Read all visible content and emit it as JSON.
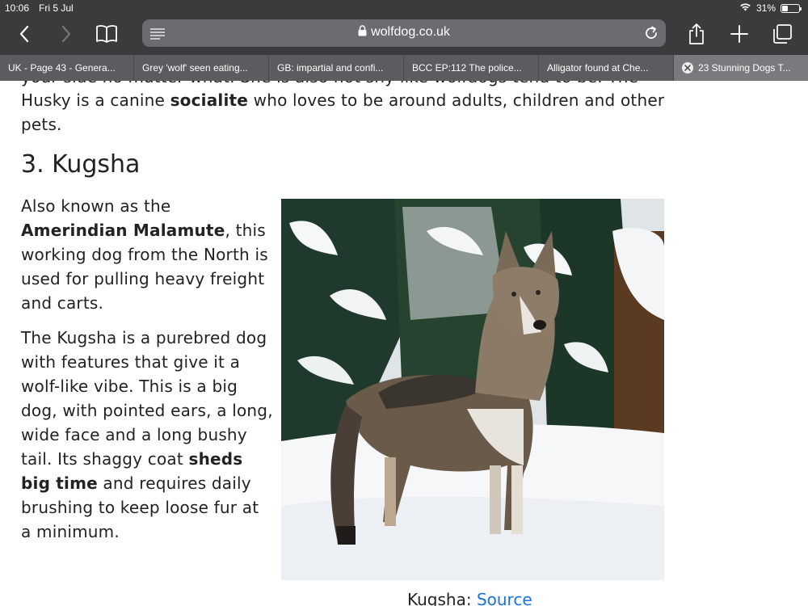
{
  "status": {
    "time": "10:06",
    "date": "Fri 5 Jul",
    "battery": "31%",
    "battery_level": 0.31
  },
  "toolbar": {
    "url": "wolfdog.co.uk"
  },
  "tabs": [
    {
      "label": "UK - Page 43 - Genera...",
      "active": false
    },
    {
      "label": "Grey 'wolf' seen eating...",
      "active": false
    },
    {
      "label": "GB: impartial and confi...",
      "active": false
    },
    {
      "label": "BCC EP:112 The police...",
      "active": false
    },
    {
      "label": "Alligator found at Che...",
      "active": false
    },
    {
      "label": "23 Stunning Dogs T...",
      "active": true
    }
  ],
  "article": {
    "clipped_line": "your side no matter what. She is also not shy like wolfdogs tend to be. The",
    "intro_pre": "Husky is a canine ",
    "intro_bold": "socialite",
    "intro_post": " who loves to be around adults, children and other pets.",
    "heading": "3. Kugsha",
    "p1_pre": "Also known as the ",
    "p1_bold": "Amerindian Malamute",
    "p1_post": ", this working dog from the North is used for pulling heavy freight and carts.",
    "p2_pre": "The Kugsha is a purebred dog with features that give it a wolf-like vibe. This is a big dog, with pointed ears, a long, wide face and a long bushy tail. Its shaggy coat ",
    "p2_bold": "sheds big time",
    "p2_post": " and requires daily brushing to keep loose fur at a minimum.",
    "caption_text": "Kugsha: ",
    "caption_link": "Source"
  },
  "colors": {
    "chrome": "#3b3b3d",
    "tab_bar": "#5c5c60",
    "link": "#1a73d9"
  }
}
